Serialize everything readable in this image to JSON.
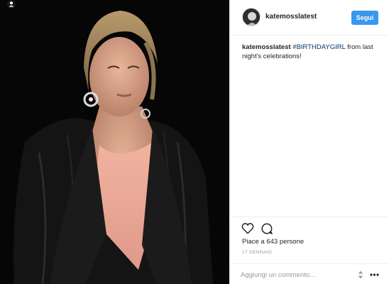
{
  "post": {
    "username": "katemosslatest",
    "follow_label": "Segui",
    "caption": {
      "username": "katemosslatest",
      "hashtag": "#BIRTHDAYGIRL",
      "text": " from last night's celebrations!"
    },
    "likes": "Piace a 643 persone",
    "date": "17 GENNAIO",
    "comment_placeholder": "Aggiungi un commento..."
  },
  "colors": {
    "follow_button": "#3897f0",
    "hashtag": "#003569",
    "photo_background": "#060606"
  },
  "icons": [
    "user-tag-icon",
    "heart-icon",
    "comment-bubble-icon",
    "more-options-icon"
  ]
}
